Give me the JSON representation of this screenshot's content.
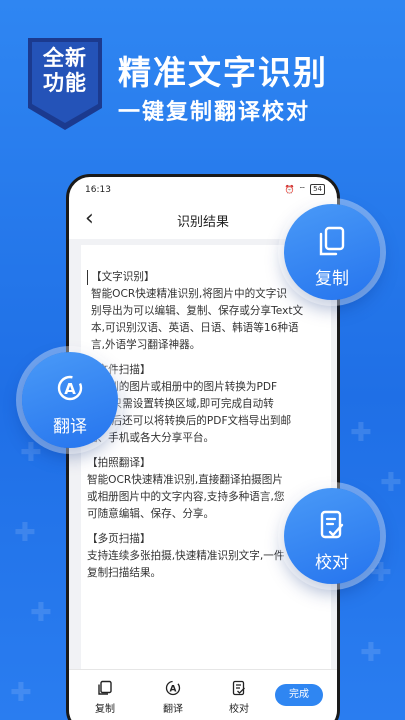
{
  "promo": {
    "badge_line1": "全新",
    "badge_line2": "功能",
    "title": "精准文字识别",
    "subtitle": "一键复制翻译校对"
  },
  "status_bar": {
    "time": "16:13",
    "battery": "54"
  },
  "nav": {
    "title": "识别结果",
    "back_icon": "chevron-left-icon"
  },
  "result_paragraphs": [
    "【文字识别】\n智能OCR快速精准识别,将图片中的文字识\n别导出为可以编辑、复制、保存或分享Text文\n本,可识别汉语、英语、日语、韩语等16种语\n言,外语学习翻译神器。",
    "【文件扫描】\n识别到的图片或相册中的图片转换为PDF\n文档,只需设置转换区域,即可完成自动转\n换,之后还可以将转换后的PDF文档导出到邮\n箱、手机或各大分享平台。",
    "【拍照翻译】\n智能OCR快速精准识别,直接翻译拍摄图片\n或相册图片中的文字内容,支持多种语言,您\n可随意编辑、保存、分享。",
    "【多页扫描】\n支持连续多张拍摄,快速精准识别文字,一件\n复制扫描结果。"
  ],
  "toolbar": {
    "copy": "复制",
    "translate": "翻译",
    "proofread": "校对",
    "done": "完成"
  },
  "bubbles": {
    "copy": "复制",
    "translate": "翻译",
    "proofread": "校对"
  },
  "colors": {
    "accent": "#2f86f2",
    "background": "#1f6fe6"
  }
}
